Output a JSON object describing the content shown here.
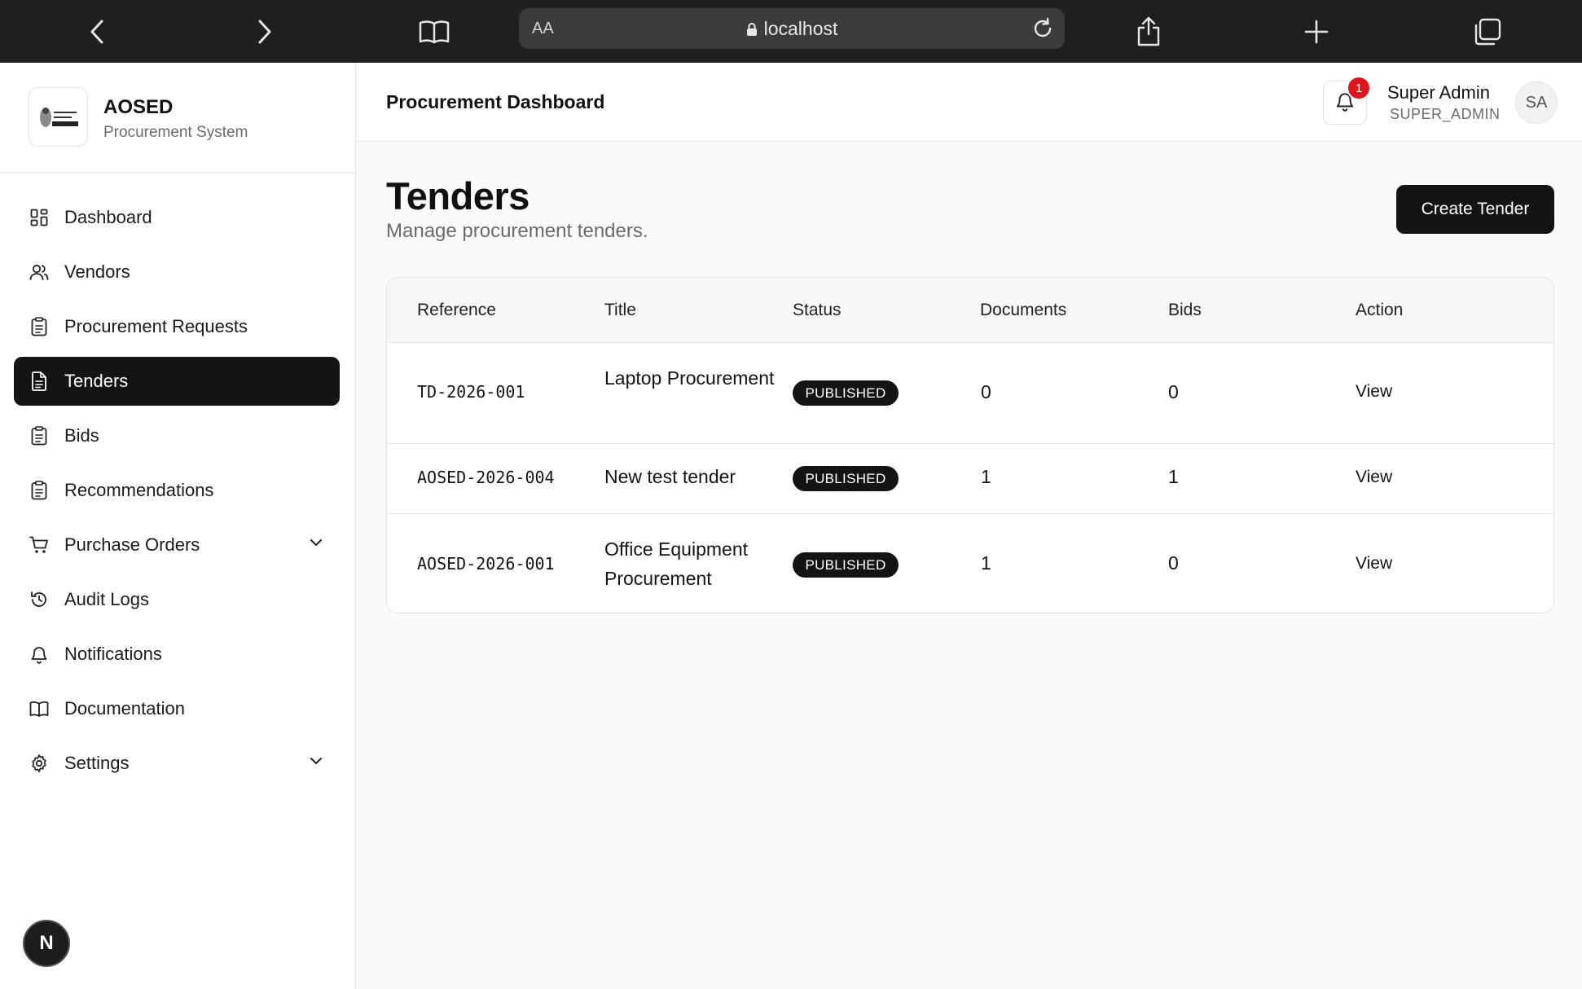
{
  "browser": {
    "url_text": "localhost",
    "aa_label": "AA"
  },
  "brand": {
    "name": "AOSED",
    "subtitle": "Procurement System"
  },
  "sidebar": {
    "items": [
      {
        "label": "Dashboard",
        "icon": "grid-icon",
        "active": false
      },
      {
        "label": "Vendors",
        "icon": "users-icon",
        "active": false
      },
      {
        "label": "Procurement Requests",
        "icon": "clipboard-icon",
        "active": false
      },
      {
        "label": "Tenders",
        "icon": "document-icon",
        "active": true
      },
      {
        "label": "Bids",
        "icon": "clipboard-icon",
        "active": false
      },
      {
        "label": "Recommendations",
        "icon": "clipboard-icon",
        "active": false
      },
      {
        "label": "Purchase Orders",
        "icon": "cart-icon",
        "active": false,
        "expandable": true
      },
      {
        "label": "Audit Logs",
        "icon": "history-icon",
        "active": false
      },
      {
        "label": "Notifications",
        "icon": "bell-icon",
        "active": false
      },
      {
        "label": "Documentation",
        "icon": "book-icon",
        "active": false
      },
      {
        "label": "Settings",
        "icon": "gear-icon",
        "active": false,
        "expandable": true
      }
    ],
    "footer_badge": "N"
  },
  "header": {
    "title": "Procurement Dashboard",
    "notification_count": "1",
    "user_name": "Super Admin",
    "user_role": "SUPER_ADMIN",
    "avatar_initials": "SA"
  },
  "page": {
    "heading": "Tenders",
    "subheading": "Manage procurement tenders.",
    "create_button": "Create Tender"
  },
  "table": {
    "columns": [
      "Reference",
      "Title",
      "Status",
      "Documents",
      "Bids",
      "Action"
    ],
    "rows": [
      {
        "reference": "TD-2026-001",
        "title": "Laptop Procurement",
        "status": "PUBLISHED",
        "documents": "0",
        "bids": "0",
        "action": "View"
      },
      {
        "reference": "AOSED-2026-004",
        "title": "New test tender",
        "status": "PUBLISHED",
        "documents": "1",
        "bids": "1",
        "action": "View"
      },
      {
        "reference": "AOSED-2026-001",
        "title": "Office Equipment Procurement",
        "status": "PUBLISHED",
        "documents": "1",
        "bids": "0",
        "action": "View"
      }
    ]
  },
  "colors": {
    "accent": "#141414",
    "badge": "#e0151b",
    "chrome": "#1f1f1f"
  }
}
